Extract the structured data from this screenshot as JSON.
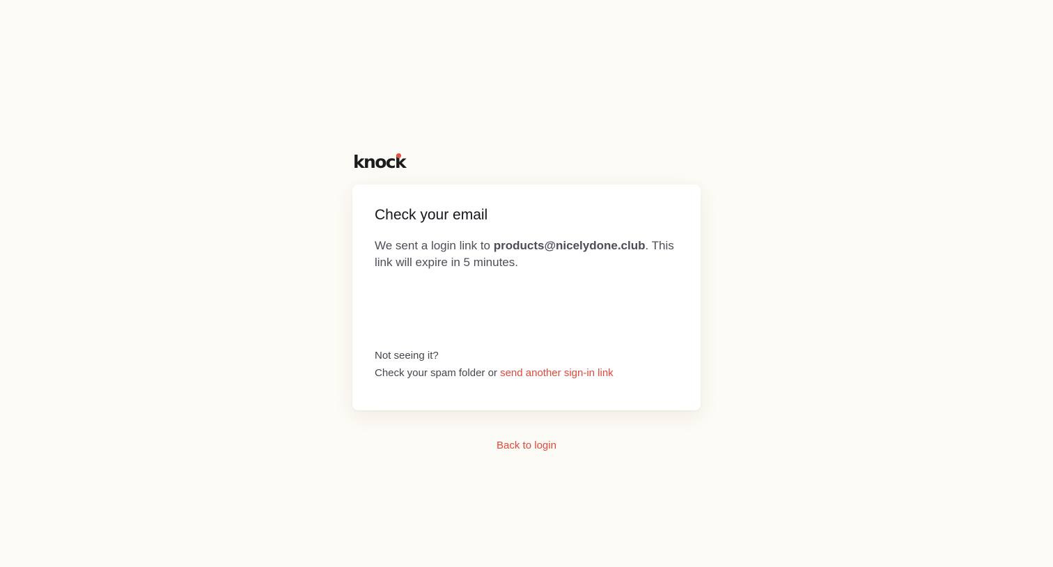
{
  "brand": {
    "logo_text": "knock",
    "accent_color": "#e44f3f"
  },
  "card": {
    "title": "Check your email",
    "message_prefix": "We sent a login link to ",
    "email": "products@nicelydone.club",
    "message_suffix": ". This link will expire in 5 minutes.",
    "help_heading": "Not seeing it?",
    "help_prefix": "Check your spam folder or ",
    "resend_link": "send another sign-in link"
  },
  "footer": {
    "back_link": "Back to login"
  },
  "colors": {
    "background": "#fdfbf5",
    "card": "#ffffff",
    "link": "#e0483a",
    "title": "#14161c",
    "body_text": "#4b4e57"
  }
}
